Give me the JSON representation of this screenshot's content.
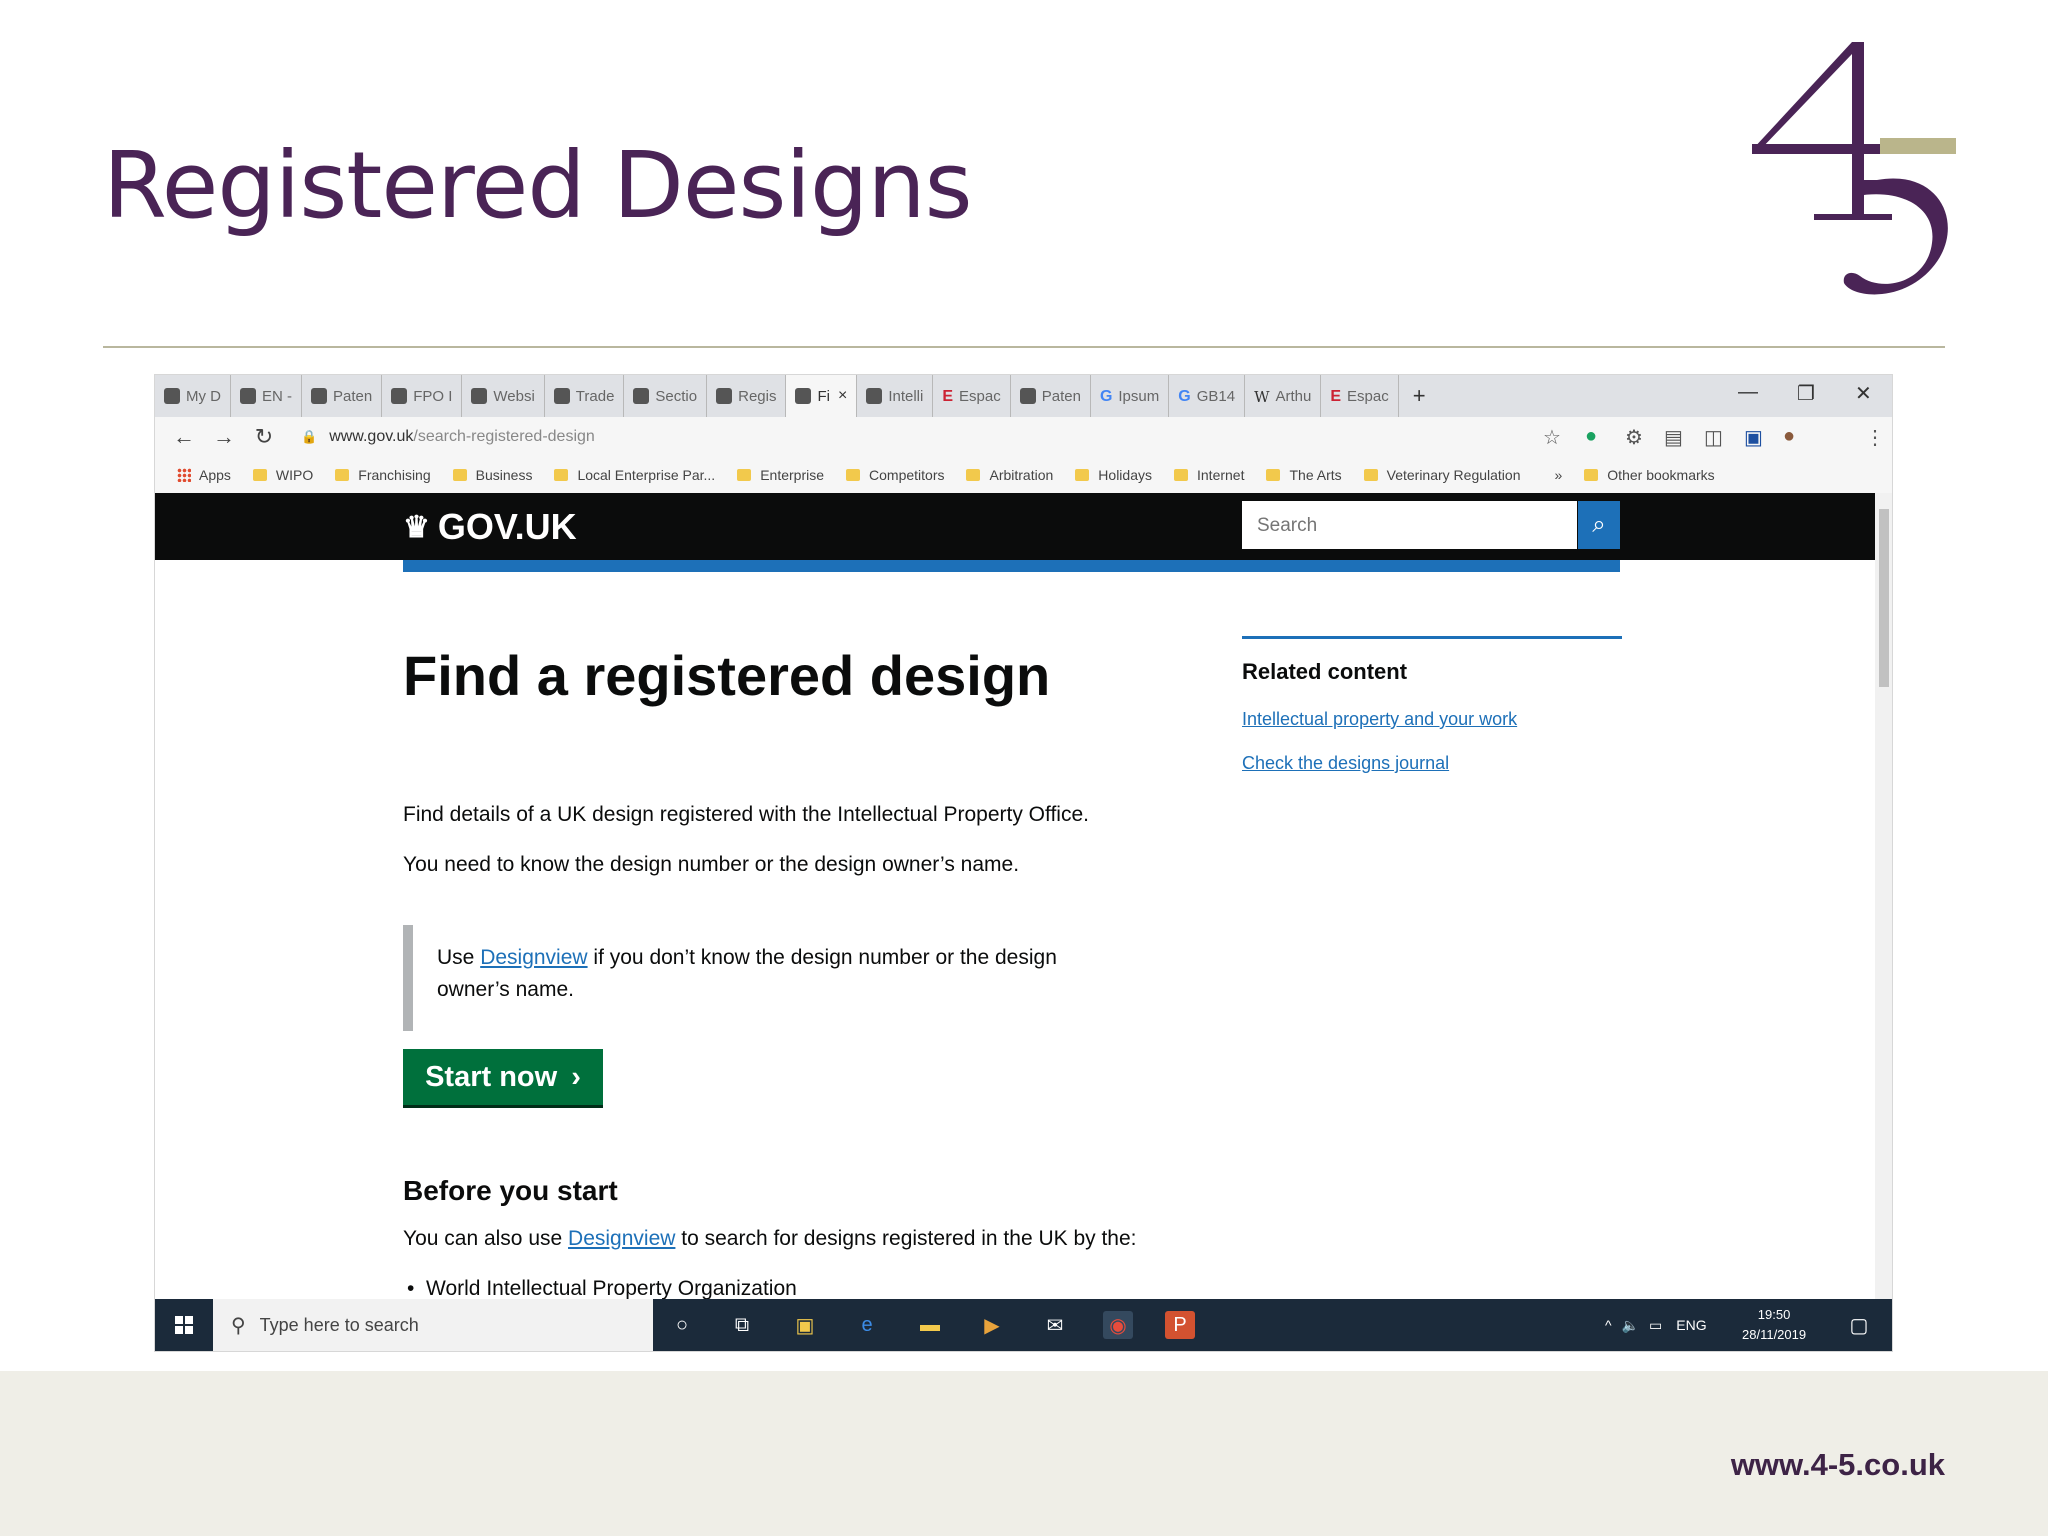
{
  "slide": {
    "title": "Registered Designs",
    "logo": {
      "top": "4",
      "bottom": "5"
    },
    "footer_url": "www.4-5.co.uk",
    "colors": {
      "title": "#4a2456",
      "accent": "#b9b79e",
      "footer_band": "#efeee7"
    }
  },
  "browser": {
    "tabs": [
      {
        "label": "My D",
        "icon": "drive-icon"
      },
      {
        "label": "EN -",
        "icon": "globe-icon"
      },
      {
        "label": "Paten",
        "icon": "page-icon"
      },
      {
        "label": "FPO I",
        "icon": "page-icon"
      },
      {
        "label": "Websi",
        "icon": "govuk-icon"
      },
      {
        "label": "Trade",
        "icon": "govuk-icon"
      },
      {
        "label": "Sectio",
        "icon": "govuk-icon"
      },
      {
        "label": "Regis",
        "icon": "govuk-icon"
      },
      {
        "label": "Fi",
        "icon": "govuk-icon",
        "active": true
      },
      {
        "label": "Intelli",
        "icon": "crest-icon"
      },
      {
        "label": "Espac",
        "icon": "espacenet-icon"
      },
      {
        "label": "Paten",
        "icon": "govuk-icon"
      },
      {
        "label": "Ipsum",
        "icon": "google-icon"
      },
      {
        "label": "GB14",
        "icon": "google-icon"
      },
      {
        "label": "Arthu",
        "icon": "wikipedia-icon"
      },
      {
        "label": "Espac",
        "icon": "espacenet-icon"
      }
    ],
    "url_domain": "www.gov.uk",
    "url_path": "/search-registered-design",
    "bookmarks": [
      "Apps",
      "WIPO",
      "Franchising",
      "Business",
      "Local Enterprise Par...",
      "Enterprise",
      "Competitors",
      "Arbitration",
      "Holidays",
      "Internet",
      "The Arts",
      "Veterinary Regulation"
    ],
    "bookmarks_overflow": "»",
    "other_bookmarks": "Other bookmarks"
  },
  "page": {
    "site_name": "GOV.UK",
    "search_placeholder": "Search",
    "heading": "Find a registered design",
    "intro_1": "Find details of a UK design registered with the Intellectual Property Office.",
    "intro_2": "You need to know the design number or the design owner’s name.",
    "inset_prefix": "Use ",
    "inset_link": "Designview",
    "inset_suffix": " if you don’t know the design number or the design",
    "inset_line2": "owner’s name.",
    "start_button": "Start now",
    "before_heading": "Before you start",
    "before_prefix": "You can also use ",
    "before_link": "Designview",
    "before_suffix": " to search for designs registered in the UK by the:",
    "bullet_1": "World Intellectual Property Organization",
    "related_title": "Related content",
    "related_links": [
      "Intellectual property and your work",
      "Check the designs journal"
    ],
    "colors": {
      "header": "#0b0c0c",
      "link": "#1d70b8",
      "button": "#00703c"
    }
  },
  "taskbar": {
    "search_placeholder": "Type here to search",
    "language": "ENG",
    "time": "19:50",
    "date": "28/11/2019"
  }
}
